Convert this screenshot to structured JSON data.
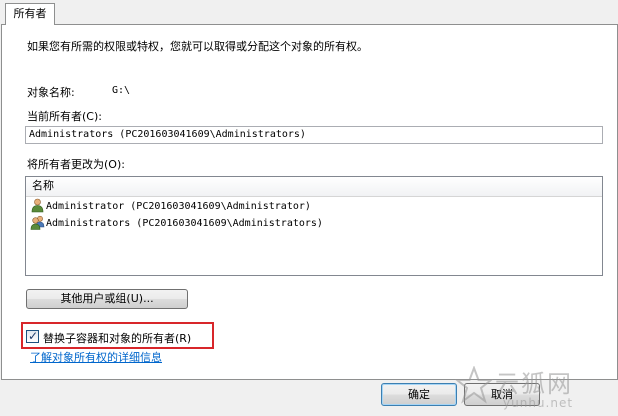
{
  "tab": {
    "label": "所有者"
  },
  "intro_text": "如果您有所需的权限或特权，您就可以取得或分配这个对象的所有权。",
  "object_name": {
    "label": "对象名称:",
    "value": "G:\\"
  },
  "current_owner": {
    "label": "当前所有者(C):",
    "value": "Administrators (PC201603041609\\Administrators)"
  },
  "change_owner": {
    "label": "将所有者更改为(O):",
    "column_header": "名称",
    "items": [
      {
        "icon": "user-icon",
        "name": "Administrator (PC201603041609\\Administrator)"
      },
      {
        "icon": "users-group-icon",
        "name": "Administrators (PC201603041609\\Administrators)"
      }
    ]
  },
  "other_users_button": "其他用户或组(U)...",
  "replace_owner_checkbox": {
    "label": "替换子容器和对象的所有者(R)",
    "checked": true
  },
  "learn_more_link": "了解对象所有权的详细信息",
  "footer": {
    "ok_label": "确定",
    "cancel_label": "取消"
  },
  "watermark": {
    "title": "云狐网",
    "url": "yunhu.net"
  },
  "colors": {
    "highlight_border": "#d8262a",
    "link": "#0066cc"
  }
}
